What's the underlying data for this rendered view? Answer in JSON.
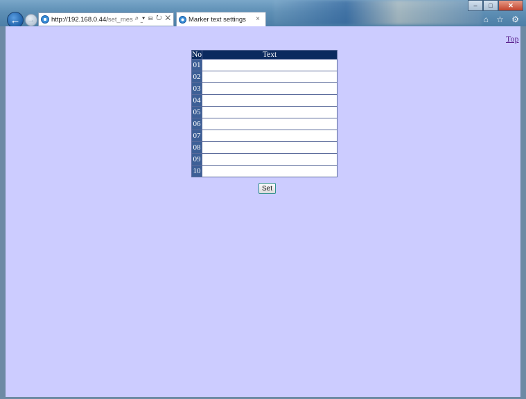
{
  "browser": {
    "url_host": "http://192.168.0.44/",
    "url_path": "set_message",
    "address_tools": "⌕ ▾ ⊟ ↻ ✕",
    "tab_title": "Marker text settings",
    "tab_close": "×",
    "back_glyph": "←",
    "forward_glyph": "→",
    "window_controls": {
      "minimize": "–",
      "maximize": "□",
      "close": "✕"
    },
    "toolbar_icons": "⌂ ☆ ⚙"
  },
  "page": {
    "top_link": "Top",
    "table": {
      "headers": {
        "no": "No",
        "text": "Text"
      },
      "rows": [
        {
          "no": "01",
          "text": ""
        },
        {
          "no": "02",
          "text": ""
        },
        {
          "no": "03",
          "text": ""
        },
        {
          "no": "04",
          "text": ""
        },
        {
          "no": "05",
          "text": ""
        },
        {
          "no": "06",
          "text": ""
        },
        {
          "no": "07",
          "text": ""
        },
        {
          "no": "08",
          "text": ""
        },
        {
          "no": "09",
          "text": ""
        },
        {
          "no": "10",
          "text": ""
        }
      ]
    },
    "set_button": "Set"
  },
  "colors": {
    "page_background": "#ccccff",
    "header_background": "#0a2a5e",
    "row_number_background": "#3d5f96",
    "link": "#551a8b"
  }
}
